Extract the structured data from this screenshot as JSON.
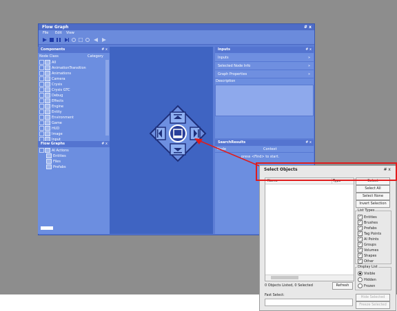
{
  "window": {
    "title": "Flow Graph",
    "controls": "# x"
  },
  "menu": [
    "File",
    "Edit",
    "View"
  ],
  "components": {
    "title": "Components",
    "controls": "# x",
    "col_name": "Node Class",
    "col_category": "Category",
    "items": [
      "All",
      "AnimationTransition",
      "Animations",
      "Camera",
      "Crysis",
      "Crysis GTC",
      "Debug",
      "Effects",
      "Engine",
      "Entity",
      "Environment",
      "Game",
      "HUD",
      "Image",
      "Input"
    ]
  },
  "flow_graphs": {
    "title": "Flow Graphs",
    "controls": "# x",
    "root": "AI Actions",
    "children": [
      "Entities",
      "Files",
      "Prefabs"
    ]
  },
  "inputs": {
    "title": "Inputs",
    "controls": "# x",
    "sections": [
      "Inputs",
      "Selected Node Info",
      "Graph Properties"
    ],
    "description_label": "Description"
  },
  "search_results": {
    "title": "SearchResults",
    "controls": "# x",
    "col_node": "Node",
    "col_context": "Context",
    "empty_text": "press <Find> to start."
  },
  "select_objects": {
    "title": "Select Objects",
    "controls": "# x",
    "col_name": "Name",
    "col_type": "Type",
    "buttons": [
      "Select",
      "Select All",
      "Select None",
      "Invert Selection"
    ],
    "list_types_label": "List Types",
    "list_types": [
      "Entities",
      "Brushes",
      "Prefabs",
      "Tag Points",
      "AI Points",
      "Groups",
      "Volumes",
      "Shapes",
      "Other"
    ],
    "display_list_label": "Display List",
    "display_options": [
      "Visible",
      "Hidden",
      "Frozen"
    ],
    "display_selected": "Visible",
    "status": "0 Objects Listed, 0 Selected",
    "refresh_label": "Refresh",
    "fast_select_label": "Fast Select:",
    "hide_selected": "Hide Selected",
    "freeze_selected": "Freeze Selected"
  }
}
